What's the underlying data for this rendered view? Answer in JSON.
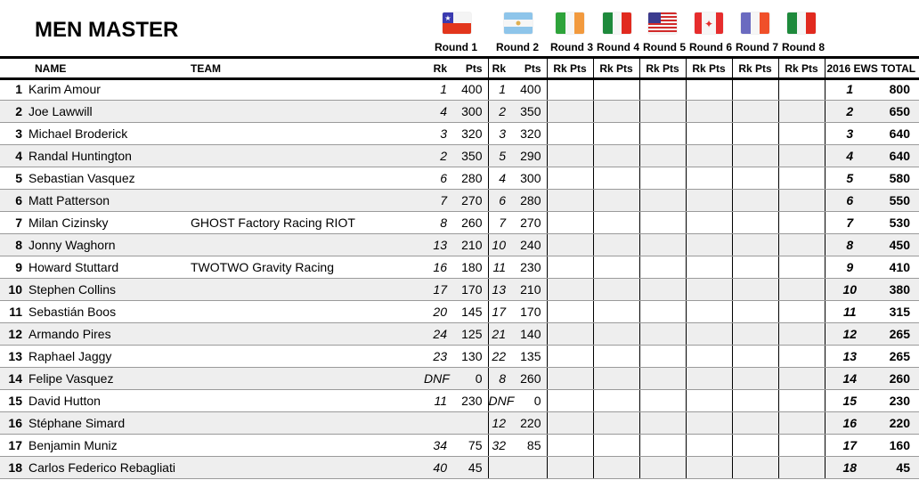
{
  "title": "MEN MASTER",
  "rounds": [
    {
      "label": "Round 1",
      "flag": "chile-flag-icon"
    },
    {
      "label": "Round 2",
      "flag": "argentina-flag-icon"
    },
    {
      "label": "Round 3",
      "flag": "ireland-flag-icon"
    },
    {
      "label": "Round 4",
      "flag": "italy-flag-icon"
    },
    {
      "label": "Round 5",
      "flag": "usa-flag-icon"
    },
    {
      "label": "Round 6",
      "flag": "canada-flag-icon"
    },
    {
      "label": "Round 7",
      "flag": "france-flag-icon"
    },
    {
      "label": "Round 8",
      "flag": "italy-flag-icon"
    }
  ],
  "headers": {
    "name": "NAME",
    "team": "TEAM",
    "rk": "Rk",
    "pts": "Pts",
    "rk_pts": "Rk Pts",
    "total": "2016 EWS TOTAL"
  },
  "rows": [
    {
      "pos": "1",
      "name": "Karim Amour",
      "team": "",
      "r1_rk": "1",
      "r1_pts": "400",
      "r2_rk": "1",
      "r2_pts": "400",
      "total_rk": "1",
      "total_pts": "800"
    },
    {
      "pos": "2",
      "name": "Joe Lawwill",
      "team": "",
      "r1_rk": "4",
      "r1_pts": "300",
      "r2_rk": "2",
      "r2_pts": "350",
      "total_rk": "2",
      "total_pts": "650"
    },
    {
      "pos": "3",
      "name": "Michael Broderick",
      "team": "",
      "r1_rk": "3",
      "r1_pts": "320",
      "r2_rk": "3",
      "r2_pts": "320",
      "total_rk": "3",
      "total_pts": "640"
    },
    {
      "pos": "4",
      "name": "Randal Huntington",
      "team": "",
      "r1_rk": "2",
      "r1_pts": "350",
      "r2_rk": "5",
      "r2_pts": "290",
      "total_rk": "4",
      "total_pts": "640"
    },
    {
      "pos": "5",
      "name": "Sebastian Vasquez",
      "team": "",
      "r1_rk": "6",
      "r1_pts": "280",
      "r2_rk": "4",
      "r2_pts": "300",
      "total_rk": "5",
      "total_pts": "580"
    },
    {
      "pos": "6",
      "name": "Matt Patterson",
      "team": "",
      "r1_rk": "7",
      "r1_pts": "270",
      "r2_rk": "6",
      "r2_pts": "280",
      "total_rk": "6",
      "total_pts": "550"
    },
    {
      "pos": "7",
      "name": "Milan Cizinsky",
      "team": "GHOST Factory Racing RIOT",
      "r1_rk": "8",
      "r1_pts": "260",
      "r2_rk": "7",
      "r2_pts": "270",
      "total_rk": "7",
      "total_pts": "530"
    },
    {
      "pos": "8",
      "name": "Jonny Waghorn",
      "team": "",
      "r1_rk": "13",
      "r1_pts": "210",
      "r2_rk": "10",
      "r2_pts": "240",
      "total_rk": "8",
      "total_pts": "450"
    },
    {
      "pos": "9",
      "name": "Howard Stuttard",
      "team": "TWOTWO Gravity Racing",
      "r1_rk": "16",
      "r1_pts": "180",
      "r2_rk": "11",
      "r2_pts": "230",
      "total_rk": "9",
      "total_pts": "410"
    },
    {
      "pos": "10",
      "name": "Stephen Collins",
      "team": "",
      "r1_rk": "17",
      "r1_pts": "170",
      "r2_rk": "13",
      "r2_pts": "210",
      "total_rk": "10",
      "total_pts": "380"
    },
    {
      "pos": "11",
      "name": "Sebastián Boos",
      "team": "",
      "r1_rk": "20",
      "r1_pts": "145",
      "r2_rk": "17",
      "r2_pts": "170",
      "total_rk": "11",
      "total_pts": "315"
    },
    {
      "pos": "12",
      "name": "Armando Pires",
      "team": "",
      "r1_rk": "24",
      "r1_pts": "125",
      "r2_rk": "21",
      "r2_pts": "140",
      "total_rk": "12",
      "total_pts": "265"
    },
    {
      "pos": "13",
      "name": "Raphael Jaggy",
      "team": "",
      "r1_rk": "23",
      "r1_pts": "130",
      "r2_rk": "22",
      "r2_pts": "135",
      "total_rk": "13",
      "total_pts": "265"
    },
    {
      "pos": "14",
      "name": "Felipe Vasquez",
      "team": "",
      "r1_rk": "DNF",
      "r1_pts": "0",
      "r2_rk": "8",
      "r2_pts": "260",
      "total_rk": "14",
      "total_pts": "260"
    },
    {
      "pos": "15",
      "name": "David Hutton",
      "team": "",
      "r1_rk": "11",
      "r1_pts": "230",
      "r2_rk": "DNF",
      "r2_pts": "0",
      "total_rk": "15",
      "total_pts": "230"
    },
    {
      "pos": "16",
      "name": "Stéphane Simard",
      "team": "",
      "r1_rk": "",
      "r1_pts": "",
      "r2_rk": "12",
      "r2_pts": "220",
      "total_rk": "16",
      "total_pts": "220"
    },
    {
      "pos": "17",
      "name": "Benjamin Muniz",
      "team": "",
      "r1_rk": "34",
      "r1_pts": "75",
      "r2_rk": "32",
      "r2_pts": "85",
      "total_rk": "17",
      "total_pts": "160"
    },
    {
      "pos": "18",
      "name": "Carlos Federico Rebagliati",
      "team": "",
      "r1_rk": "40",
      "r1_pts": "45",
      "r2_rk": "",
      "r2_pts": "",
      "total_rk": "18",
      "total_pts": "45"
    }
  ]
}
